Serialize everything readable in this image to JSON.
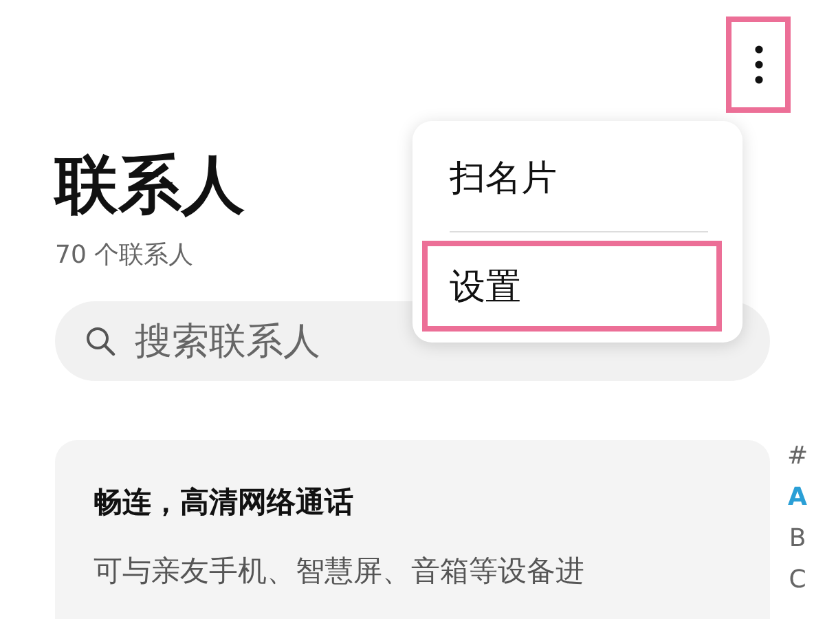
{
  "more_button": {
    "highlighted": true
  },
  "title": "联系人",
  "subtitle": "70 个联系人",
  "search": {
    "placeholder": "搜索联系人"
  },
  "promo_card": {
    "title": "畅连，高清网络通话",
    "body": "可与亲友手机、智慧屏、音箱等设备进"
  },
  "index": [
    {
      "label": "#",
      "selected": false
    },
    {
      "label": "A",
      "selected": true
    },
    {
      "label": "B",
      "selected": false
    },
    {
      "label": "C",
      "selected": false
    }
  ],
  "menu": {
    "items": [
      {
        "label": "扫名片",
        "highlighted": false
      },
      {
        "label": "设置",
        "highlighted": true
      }
    ]
  }
}
